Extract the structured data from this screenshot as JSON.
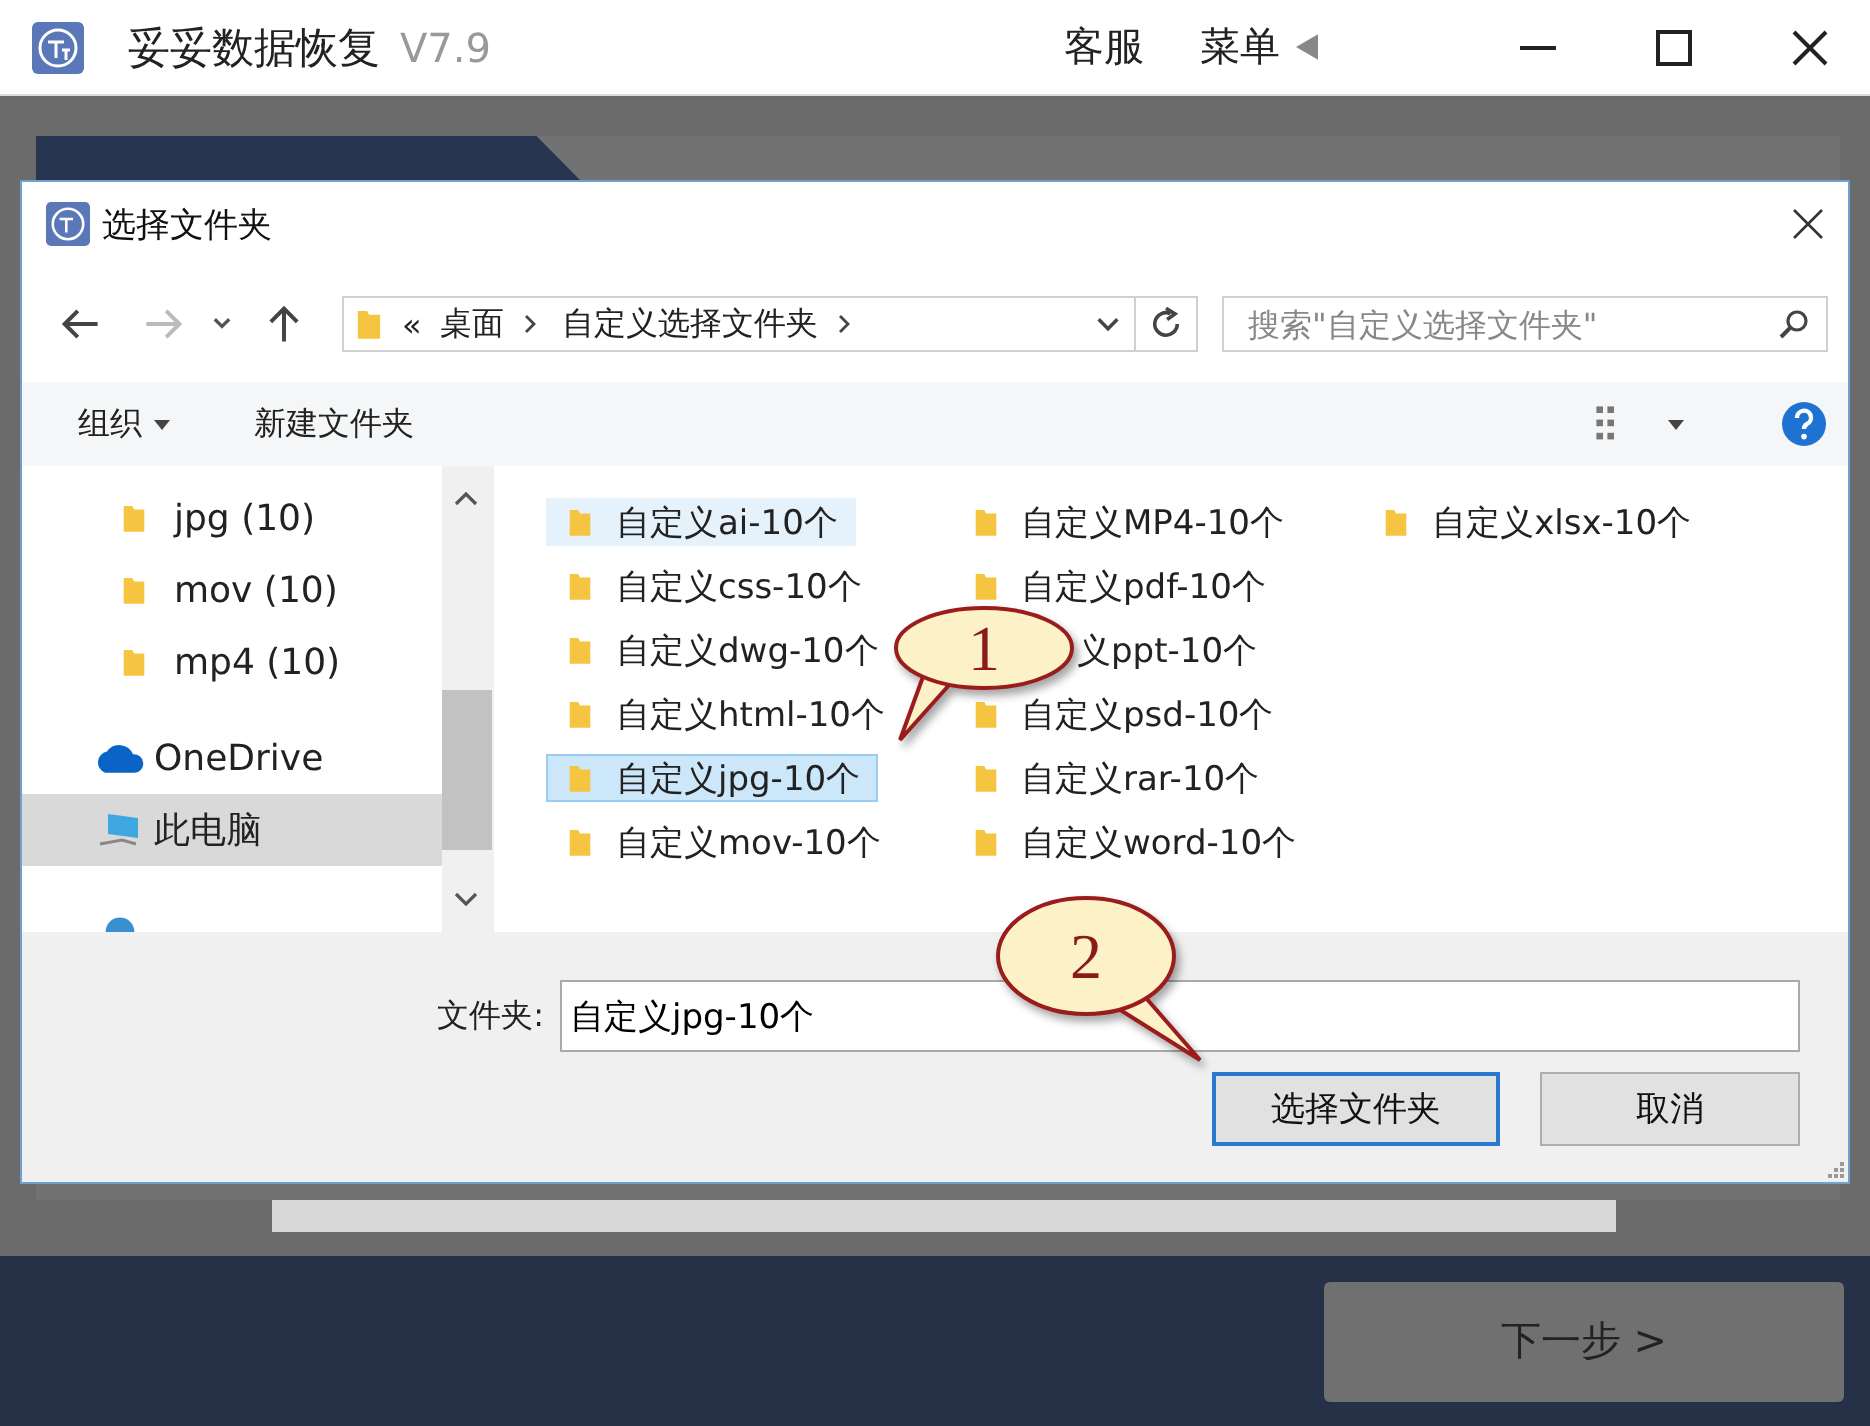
{
  "app": {
    "title": "妥妥数据恢复",
    "version": "V7.9",
    "menu_items": [
      "客服",
      "菜单"
    ]
  },
  "dialog": {
    "title": "选择文件夹",
    "address": {
      "prefix": "«",
      "path": [
        "桌面",
        "自定义选择文件夹"
      ]
    },
    "search": {
      "placeholder": "搜索\"自定义选择文件夹\""
    },
    "toolbar": {
      "organize": "组织",
      "new_folder": "新建文件夹"
    },
    "nav_pane": [
      {
        "label": "jpg (10)",
        "kind": "folder",
        "selected": false
      },
      {
        "label": "mov (10)",
        "kind": "folder",
        "selected": false
      },
      {
        "label": "mp4 (10)",
        "kind": "folder",
        "selected": false
      },
      {
        "label": "OneDrive",
        "kind": "cloud",
        "selected": false
      },
      {
        "label": "此电脑",
        "kind": "computer",
        "selected": true
      }
    ],
    "files": [
      {
        "name": "自定义ai-10个",
        "selected": false,
        "hovered": true
      },
      {
        "name": "自定义css-10个",
        "selected": false,
        "hovered": false
      },
      {
        "name": "自定义dwg-10个",
        "selected": false,
        "hovered": false
      },
      {
        "name": "自定义html-10个",
        "selected": false,
        "hovered": false
      },
      {
        "name": "自定义jpg-10个",
        "selected": true,
        "hovered": false
      },
      {
        "name": "自定义mov-10个",
        "selected": false,
        "hovered": false
      },
      {
        "name": "自定义MP4-10个",
        "selected": false,
        "hovered": false
      },
      {
        "name": "自定义pdf-10个",
        "selected": false,
        "hovered": false
      },
      {
        "name": "义ppt-10个",
        "selected": false,
        "hovered": false,
        "partial": true
      },
      {
        "name": "自定义psd-10个",
        "selected": false,
        "hovered": false
      },
      {
        "name": "自定义rar-10个",
        "selected": false,
        "hovered": false
      },
      {
        "name": "自定义word-10个",
        "selected": false,
        "hovered": false
      },
      {
        "name": "自定义xlsx-10个",
        "selected": false,
        "hovered": false
      }
    ],
    "folder_label": "文件夹:",
    "folder_value": "自定义jpg-10个",
    "buttons": [
      {
        "label": "选择文件夹",
        "primary": true
      },
      {
        "label": "取消",
        "primary": false
      }
    ]
  },
  "callouts": [
    {
      "text": "1"
    },
    {
      "text": "2"
    }
  ],
  "next_button": "下一步 >"
}
